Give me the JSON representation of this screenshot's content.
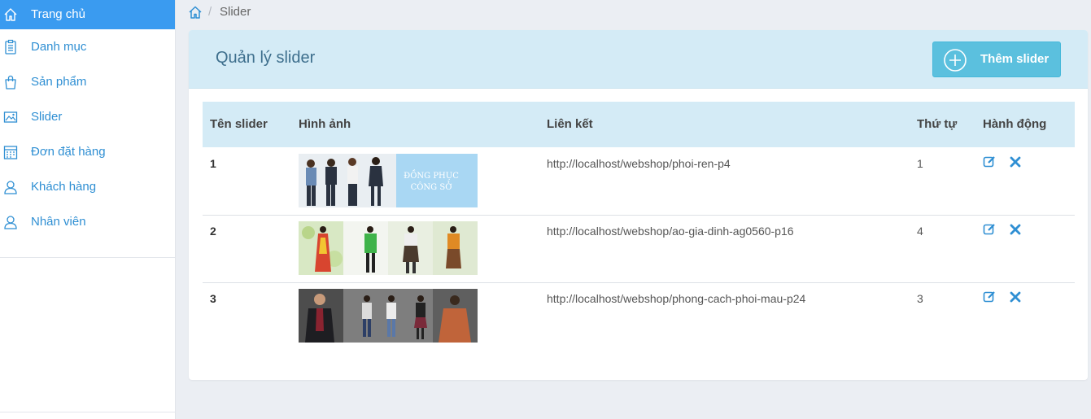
{
  "sidebar": {
    "items": [
      {
        "label": "Trang chủ",
        "icon": "home-icon",
        "active": true
      },
      {
        "label": "Danh mục",
        "icon": "clipboard-list-icon",
        "active": false
      },
      {
        "label": "Sản phẩm",
        "icon": "shopping-bag-icon",
        "active": false
      },
      {
        "label": "Slider",
        "icon": "image-icon",
        "active": false
      },
      {
        "label": "Đơn đặt hàng",
        "icon": "calendar-icon",
        "active": false
      },
      {
        "label": "Khách hàng",
        "icon": "user-icon",
        "active": false
      },
      {
        "label": "Nhân viên",
        "icon": "user-icon",
        "active": false
      }
    ]
  },
  "breadcrumb": {
    "home_icon": "home-icon",
    "separator": "/",
    "current": "Slider"
  },
  "panel": {
    "title": "Quản lý slider",
    "add_button": "Thêm slider",
    "add_icon": "plus-circle-icon"
  },
  "table": {
    "headers": [
      "Tên slider",
      "Hình ảnh",
      "Liên kết",
      "Thứ tự",
      "Hành động"
    ],
    "rows": [
      {
        "name": "1",
        "image_text_line1": "ĐỒNG PHỤC",
        "image_text_line2": "CÔNG SỞ",
        "link": "http://localhost/webshop/phoi-ren-p4",
        "order": "1"
      },
      {
        "name": "2",
        "link": "http://localhost/webshop/ao-gia-dinh-ag0560-p16",
        "order": "4"
      },
      {
        "name": "3",
        "link": "http://localhost/webshop/phong-cach-phoi-mau-p24",
        "order": "3"
      }
    ],
    "action_icons": [
      "edit-icon",
      "delete-icon"
    ]
  },
  "colors": {
    "accent": "#3a9bf0",
    "link_text": "#2f8fd3",
    "header_bg": "#d4ebf6",
    "button": "#5bc0de",
    "page_bg": "#ebeef3"
  }
}
